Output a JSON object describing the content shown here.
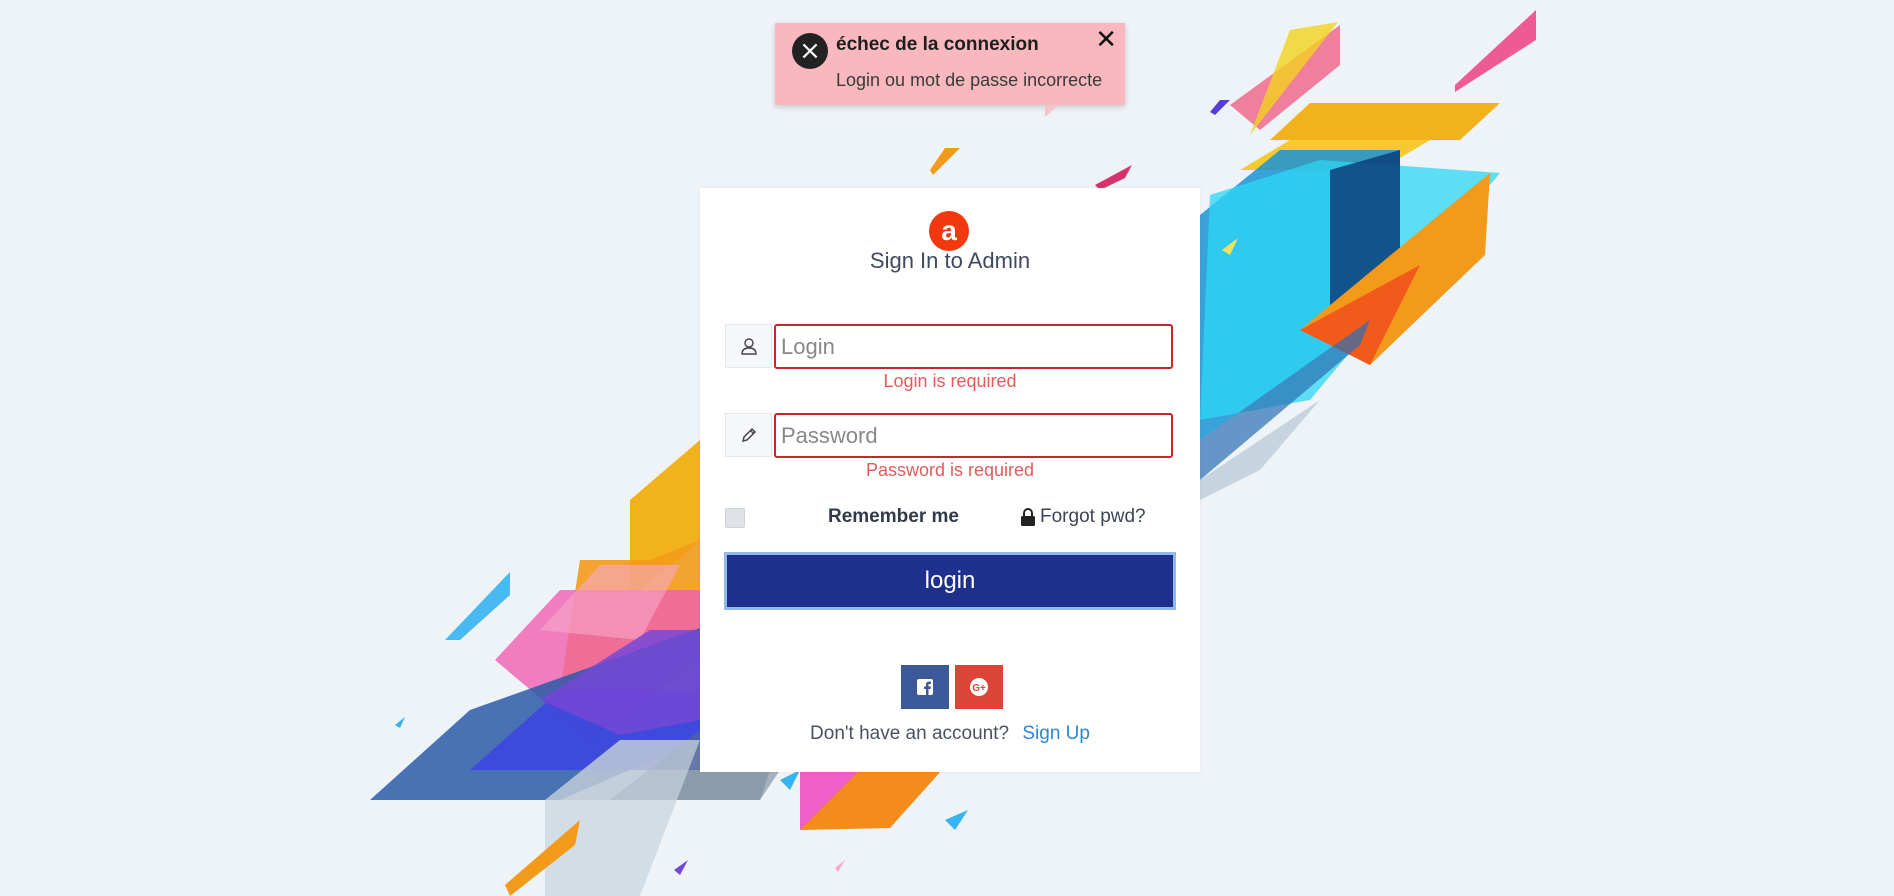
{
  "toast": {
    "title": "échec de la connexion",
    "message": "Login ou mot de passe incorrecte",
    "close_icon": "close-icon",
    "status_color": "#f8b8be"
  },
  "login_card": {
    "logo_letter": "a",
    "title": "Sign In to Admin",
    "login": {
      "placeholder": "Login",
      "value": "",
      "error": "Login is required",
      "icon": "user-icon"
    },
    "password": {
      "placeholder": "Password",
      "value": "",
      "error": "Password is required",
      "icon": "pencil-icon"
    },
    "remember_label": "Remember me",
    "remember_checked": false,
    "forgot_label": "Forgot pwd?",
    "login_button": "login",
    "signup_prompt": "Don't have an account?",
    "signup_link": "Sign Up",
    "social": [
      "facebook-icon",
      "google-plus-icon"
    ]
  },
  "colors": {
    "button": "#1f2f8c",
    "error": "#e35b5b",
    "brand": "#f2380f",
    "facebook": "#3b5998",
    "google": "#db4437",
    "link": "#2f86d6"
  }
}
